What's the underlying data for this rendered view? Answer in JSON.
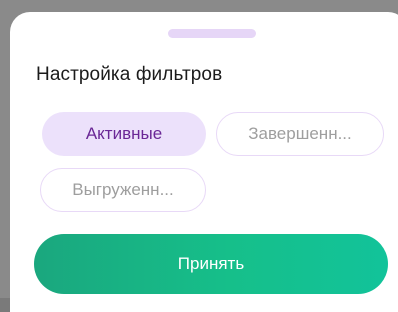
{
  "sheet": {
    "title": "Настройка фильтров"
  },
  "filters": {
    "chips": [
      {
        "label": "Активные",
        "selected": true
      },
      {
        "label": "Завершенн...",
        "selected": false
      },
      {
        "label": "Выгруженн...",
        "selected": false
      }
    ]
  },
  "actions": {
    "accept_label": "Принять"
  },
  "colors": {
    "accent_green": "#16bf8a",
    "chip_selected_bg": "#ece1fb",
    "chip_selected_text": "#6a2796",
    "chip_border": "#e8d9f7"
  }
}
